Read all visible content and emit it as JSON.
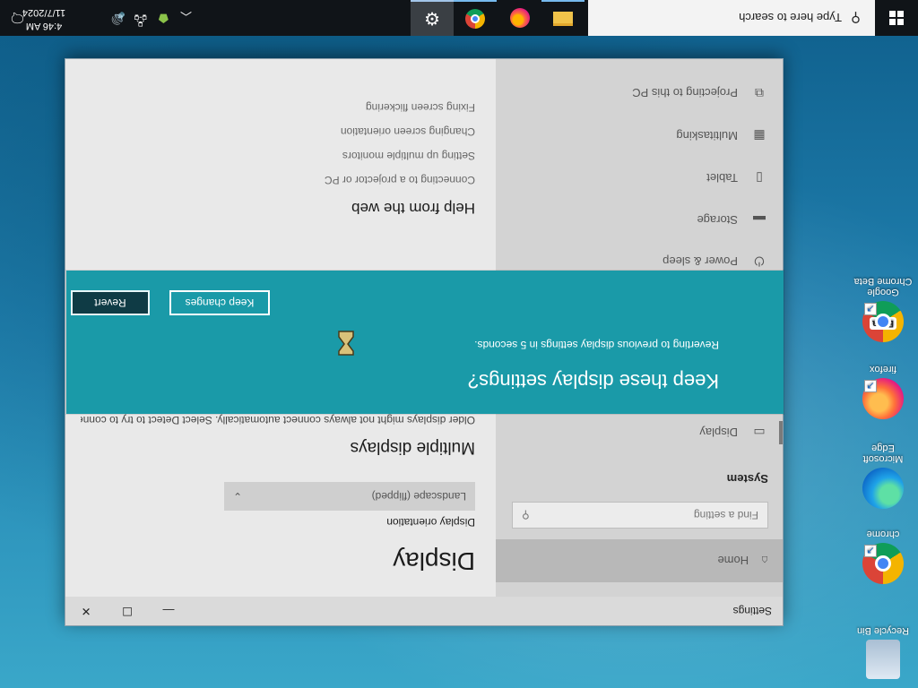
{
  "taskbar": {
    "search_placeholder": "Type here to search",
    "apps": [
      "settings-icon",
      "chrome-icon",
      "firefox-icon",
      "file-explorer-icon"
    ],
    "clock_time": "4:46 AM",
    "clock_date": "11/7/2024"
  },
  "desktop": {
    "icons": [
      {
        "label": "Recycle Bin"
      },
      {
        "label": "chrome"
      },
      {
        "label": "Microsoft Edge"
      },
      {
        "label": "firefox"
      },
      {
        "label": "Google Chrome Beta",
        "badge": "Beta"
      }
    ]
  },
  "settings": {
    "window_title": "Settings",
    "nav": {
      "home": "Home",
      "search_placeholder": "Find a setting",
      "section": "System",
      "items": [
        {
          "label": "Display",
          "icon": "monitor-icon"
        },
        {
          "label": "Power & sleep",
          "icon": "power-icon"
        },
        {
          "label": "Storage",
          "icon": "storage-icon"
        },
        {
          "label": "Tablet",
          "icon": "tablet-icon"
        },
        {
          "label": "Multitasking",
          "icon": "multitasking-icon"
        },
        {
          "label": "Projecting to this PC",
          "icon": "projecting-icon"
        }
      ]
    },
    "content": {
      "title": "Display",
      "orientation_label": "Display orientation",
      "orientation_value": "Landscape (flipped)",
      "multiple_displays": "Multiple displays",
      "multiple_text": "Older displays might not always connect automatically. Select Detect to try to connect to them.",
      "help_title": "Help from the web",
      "help_links": [
        "Connecting to a projector or PC",
        "Setting up multiple monitors",
        "Changing screen orientation",
        "Fixing screen flickering"
      ]
    }
  },
  "dialog": {
    "title": "Keep these display settings?",
    "message": "Reverting to previous display settings in  5 seconds.",
    "keep_label": "Keep changes",
    "revert_label": "Revert"
  },
  "colors": {
    "dialog_bg": "#1a9aa8",
    "revert_bg": "#0f3b45",
    "taskbar_bg": "#101418"
  }
}
